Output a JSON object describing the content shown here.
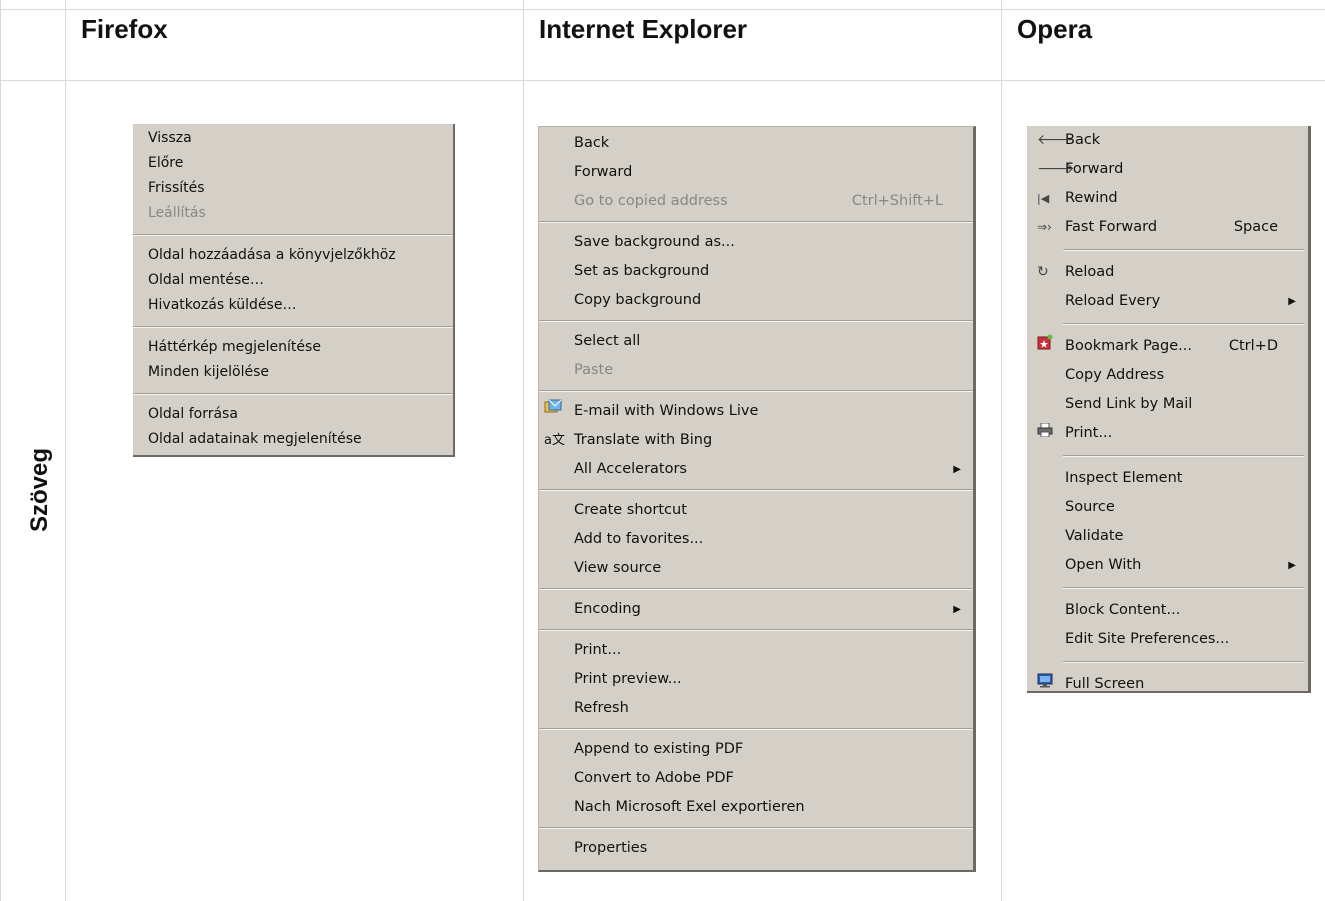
{
  "headers": {
    "firefox": "Firefox",
    "ie": "Internet Explorer",
    "opera": "Opera"
  },
  "row_label": "Szöveg",
  "firefox_menu": {
    "groups": [
      [
        "Vissza",
        "Előre",
        "Frissítés",
        "Leállítás"
      ],
      [
        "Oldal hozzáadása a könyvjelzőkhöz",
        "Oldal mentése…",
        "Hivatkozás küldése…"
      ],
      [
        "Háttérkép megjelenítése",
        "Minden kijelölése"
      ],
      [
        "Oldal forrása",
        "Oldal adatainak megjelenítése"
      ]
    ]
  },
  "ie_menu": {
    "back": "Back",
    "forward": "Forward",
    "go_copied": "Go to copied address",
    "go_copied_shortcut": "Ctrl+Shift+L",
    "save_bg": "Save background as...",
    "set_bg": "Set as background",
    "copy_bg": "Copy background",
    "select_all": "Select all",
    "paste": "Paste",
    "email_live": "E-mail with Windows Live",
    "translate_bing": "Translate with Bing",
    "all_accel": "All Accelerators",
    "create_shortcut": "Create shortcut",
    "add_fav": "Add to favorites...",
    "view_source": "View source",
    "encoding": "Encoding",
    "print": "Print...",
    "print_preview": "Print preview...",
    "refresh": "Refresh",
    "append_pdf": "Append to existing PDF",
    "convert_pdf": "Convert to Adobe PDF",
    "export_excel": "Nach Microsoft Exel exportieren",
    "properties": "Properties",
    "translate_icon_glyph": "a文"
  },
  "opera_menu": {
    "back": "Back",
    "forward": "Forward",
    "rewind": "Rewind",
    "fast_forward": "Fast Forward",
    "fast_forward_shortcut": "Space",
    "reload": "Reload",
    "reload_every": "Reload Every",
    "bookmark": "Bookmark Page...",
    "bookmark_shortcut": "Ctrl+D",
    "copy_address": "Copy Address",
    "send_link": "Send Link by Mail",
    "print": "Print...",
    "inspect": "Inspect Element",
    "source": "Source",
    "validate": "Validate",
    "open_with": "Open With",
    "block_content": "Block Content...",
    "edit_site_prefs": "Edit Site Preferences...",
    "full_screen": "Full Screen"
  }
}
